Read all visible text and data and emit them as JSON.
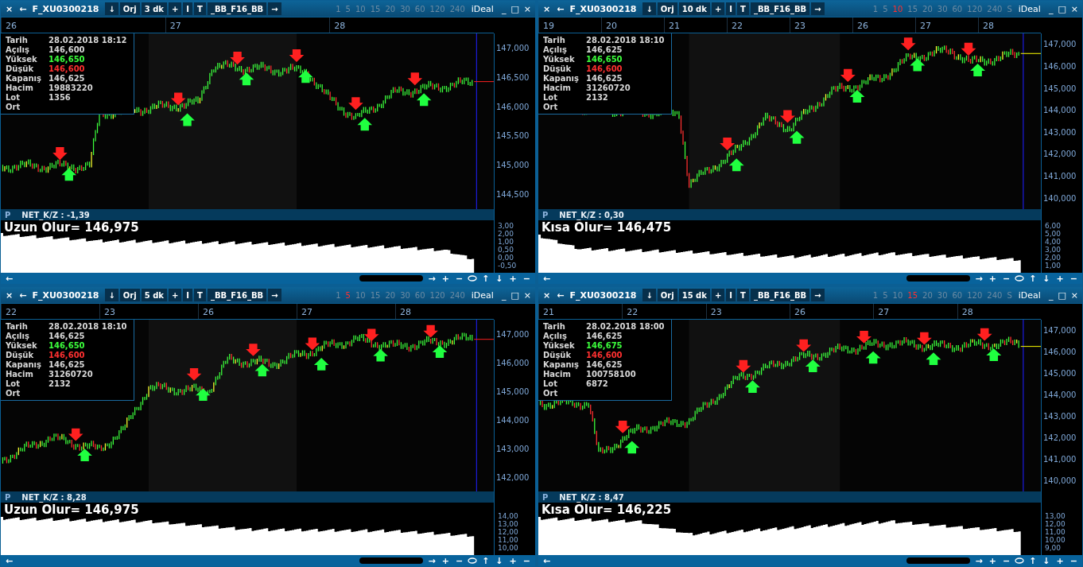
{
  "panels": [
    {
      "lead": [
        "×",
        "←"
      ],
      "symbol": "F_XU0300218",
      "toolbar": [
        "↓",
        "Orj",
        "3 dk",
        "+",
        "I",
        "T",
        "_BB_F16_BB",
        "→"
      ],
      "periods": [
        {
          "label": "1",
          "selected": false
        },
        {
          "label": "5",
          "selected": false
        },
        {
          "label": "10",
          "selected": false
        },
        {
          "label": "15",
          "selected": false
        },
        {
          "label": "20",
          "selected": false
        },
        {
          "label": "30",
          "selected": false
        },
        {
          "label": "60",
          "selected": false
        },
        {
          "label": "120",
          "selected": false
        },
        {
          "label": "240",
          "selected": false
        }
      ],
      "brand": "iDeal",
      "window_controls": [
        "_",
        "□",
        "×"
      ],
      "dates": [
        "26",
        "27",
        "28"
      ],
      "info": [
        {
          "label": "Tarih",
          "value": "28.02.2018 18:12",
          "kind": "plain"
        },
        {
          "label": "Açılış",
          "value": "146,600",
          "kind": "plain"
        },
        {
          "label": "Yüksek",
          "value": "146,650",
          "kind": "high"
        },
        {
          "label": "Düşük",
          "value": "146,600",
          "kind": "low"
        },
        {
          "label": "Kapanış",
          "value": "146,625",
          "kind": "plain"
        },
        {
          "label": "Hacim",
          "value": "19883220",
          "kind": "plain"
        },
        {
          "label": "Lot",
          "value": "1356",
          "kind": "plain"
        },
        {
          "label": "Ort"
        }
      ],
      "price_ticks": [
        "147,000",
        "146,500",
        "146,000",
        "145,500",
        "145,000",
        "144,500"
      ],
      "indicator": {
        "prefix": "P",
        "title": "NET_K/Z : -1,39",
        "signal": "Uzun Olur= 146,975",
        "ticks": [
          "3,00",
          "2,00",
          "1,00",
          "0,50",
          "0,00",
          "-0,50"
        ]
      },
      "bottom": [
        {
          "kind": "text",
          "text": "+"
        },
        {
          "kind": "text",
          "text": "−"
        },
        {
          "kind": "oval"
        },
        {
          "kind": "text",
          "text": "↑"
        },
        {
          "kind": "text",
          "text": "↓"
        },
        {
          "kind": "text",
          "text": "+"
        },
        {
          "kind": "text",
          "text": "−"
        }
      ],
      "scroll_left": "←",
      "scroll_right": "→"
    },
    {
      "lead": [
        "×",
        "←"
      ],
      "symbol": "F_XU0300218",
      "toolbar": [
        "↓",
        "Orj",
        "10 dk",
        "+",
        "I",
        "T",
        "_BB_F16_BB",
        "→"
      ],
      "periods": [
        {
          "label": "1",
          "selected": false
        },
        {
          "label": "5",
          "selected": false
        },
        {
          "label": "10",
          "selected": true
        },
        {
          "label": "15",
          "selected": false
        },
        {
          "label": "20",
          "selected": false
        },
        {
          "label": "30",
          "selected": false
        },
        {
          "label": "60",
          "selected": false
        },
        {
          "label": "120",
          "selected": false
        },
        {
          "label": "240",
          "selected": false
        },
        {
          "label": "S",
          "selected": false
        }
      ],
      "brand": "iDeal",
      "window_controls": [
        "_",
        "□",
        "×"
      ],
      "dates": [
        "19",
        "20",
        "21",
        "22",
        "23",
        "26",
        "27",
        "28"
      ],
      "info": [
        {
          "label": "Tarih",
          "value": "28.02.2018 18:10",
          "kind": "plain"
        },
        {
          "label": "Açılış",
          "value": "146,625",
          "kind": "plain"
        },
        {
          "label": "Yüksek",
          "value": "146,650",
          "kind": "high"
        },
        {
          "label": "Düşük",
          "value": "146,600",
          "kind": "low"
        },
        {
          "label": "Kapanış",
          "value": "146,625",
          "kind": "plain"
        },
        {
          "label": "Hacim",
          "value": "31260720",
          "kind": "plain"
        },
        {
          "label": "Lot",
          "value": "2132",
          "kind": "plain"
        },
        {
          "label": "Ort"
        }
      ],
      "price_ticks": [
        "147,000",
        "146,000",
        "145,000",
        "144,000",
        "143,000",
        "142,000",
        "141,000",
        "140,000"
      ],
      "indicator": {
        "prefix": "P",
        "title": "NET_K/Z : 0,30",
        "signal": "Kısa Olur= 146,475",
        "ticks": [
          "6,00",
          "5,00",
          "4,00",
          "3,00",
          "2,00",
          "1,00"
        ]
      },
      "bottom": [
        {
          "kind": "text",
          "text": "+"
        },
        {
          "kind": "text",
          "text": "−"
        },
        {
          "kind": "oval"
        },
        {
          "kind": "text",
          "text": "↑"
        },
        {
          "kind": "text",
          "text": "↓"
        },
        {
          "kind": "text",
          "text": "+"
        },
        {
          "kind": "text",
          "text": "−"
        }
      ],
      "scroll_left": "←",
      "scroll_right": "→"
    },
    {
      "lead": [
        "×",
        "←"
      ],
      "symbol": "F_XU0300218",
      "toolbar": [
        "↓",
        "Orj",
        "5 dk",
        "+",
        "I",
        "T",
        "_BB_F16_BB",
        "→"
      ],
      "periods": [
        {
          "label": "1",
          "selected": false
        },
        {
          "label": "5",
          "selected": true
        },
        {
          "label": "10",
          "selected": false
        },
        {
          "label": "15",
          "selected": false
        },
        {
          "label": "20",
          "selected": false
        },
        {
          "label": "30",
          "selected": false
        },
        {
          "label": "60",
          "selected": false
        },
        {
          "label": "120",
          "selected": false
        },
        {
          "label": "240",
          "selected": false
        }
      ],
      "brand": "iDeal",
      "window_controls": [
        "_",
        "□",
        "×"
      ],
      "dates": [
        "22",
        "23",
        "26",
        "27",
        "28"
      ],
      "info": [
        {
          "label": "Tarih",
          "value": "28.02.2018 18:10",
          "kind": "plain"
        },
        {
          "label": "Açılış",
          "value": "146,625",
          "kind": "plain"
        },
        {
          "label": "Yüksek",
          "value": "146,650",
          "kind": "high"
        },
        {
          "label": "Düşük",
          "value": "146,600",
          "kind": "low"
        },
        {
          "label": "Kapanış",
          "value": "146,625",
          "kind": "plain"
        },
        {
          "label": "Hacim",
          "value": "31260720",
          "kind": "plain"
        },
        {
          "label": "Lot",
          "value": "2132",
          "kind": "plain"
        },
        {
          "label": "Ort"
        }
      ],
      "price_ticks": [
        "147,000",
        "146,000",
        "145,000",
        "144,000",
        "143,000",
        "142,000"
      ],
      "indicator": {
        "prefix": "P",
        "title": "NET_K/Z : 8,28",
        "signal": "Uzun Olur= 146,975",
        "ticks": [
          "14,00",
          "13,00",
          "12,00",
          "11,00",
          "10,00"
        ]
      },
      "bottom": [
        {
          "kind": "text",
          "text": "+"
        },
        {
          "kind": "text",
          "text": "−"
        },
        {
          "kind": "oval"
        },
        {
          "kind": "text",
          "text": "↑"
        },
        {
          "kind": "text",
          "text": "↓"
        },
        {
          "kind": "text",
          "text": "+"
        },
        {
          "kind": "text",
          "text": "−"
        }
      ],
      "scroll_left": "←",
      "scroll_right": "→"
    },
    {
      "lead": [
        "×",
        "←"
      ],
      "symbol": "F_XU0300218",
      "toolbar": [
        "↓",
        "Orj",
        "15 dk",
        "+",
        "I",
        "T",
        "_BB_F16_BB",
        "→"
      ],
      "periods": [
        {
          "label": "1",
          "selected": false
        },
        {
          "label": "5",
          "selected": false
        },
        {
          "label": "10",
          "selected": false
        },
        {
          "label": "15",
          "selected": true
        },
        {
          "label": "20",
          "selected": false
        },
        {
          "label": "30",
          "selected": false
        },
        {
          "label": "60",
          "selected": false
        },
        {
          "label": "120",
          "selected": false
        },
        {
          "label": "240",
          "selected": false
        },
        {
          "label": "S",
          "selected": false
        }
      ],
      "brand": "iDeal",
      "window_controls": [
        "_",
        "□",
        "×"
      ],
      "dates": [
        "21",
        "22",
        "23",
        "26",
        "27",
        "28"
      ],
      "info": [
        {
          "label": "Tarih",
          "value": "28.02.2018 18:00",
          "kind": "plain"
        },
        {
          "label": "Açılış",
          "value": "146,625",
          "kind": "plain"
        },
        {
          "label": "Yüksek",
          "value": "146,675",
          "kind": "high"
        },
        {
          "label": "Düşük",
          "value": "146,600",
          "kind": "low"
        },
        {
          "label": "Kapanış",
          "value": "146,625",
          "kind": "plain"
        },
        {
          "label": "Hacim",
          "value": "100758100",
          "kind": "plain"
        },
        {
          "label": "Lot",
          "value": "6872",
          "kind": "plain"
        },
        {
          "label": "Ort"
        }
      ],
      "price_ticks": [
        "147,000",
        "146,000",
        "145,000",
        "144,000",
        "143,000",
        "142,000",
        "141,000",
        "140,000"
      ],
      "indicator": {
        "prefix": "P",
        "title": "NET_K/Z : 8,47",
        "signal": "Kısa Olur= 146,225",
        "ticks": [
          "13,00",
          "12,00",
          "11,00",
          "10,00",
          "9,00"
        ]
      },
      "bottom": [
        {
          "kind": "text",
          "text": "+"
        },
        {
          "kind": "text",
          "text": "−"
        },
        {
          "kind": "oval"
        },
        {
          "kind": "text",
          "text": "↑"
        },
        {
          "kind": "text",
          "text": "↓"
        },
        {
          "kind": "text",
          "text": "+"
        },
        {
          "kind": "text",
          "text": "−"
        }
      ],
      "scroll_left": "←",
      "scroll_right": "→"
    }
  ]
}
